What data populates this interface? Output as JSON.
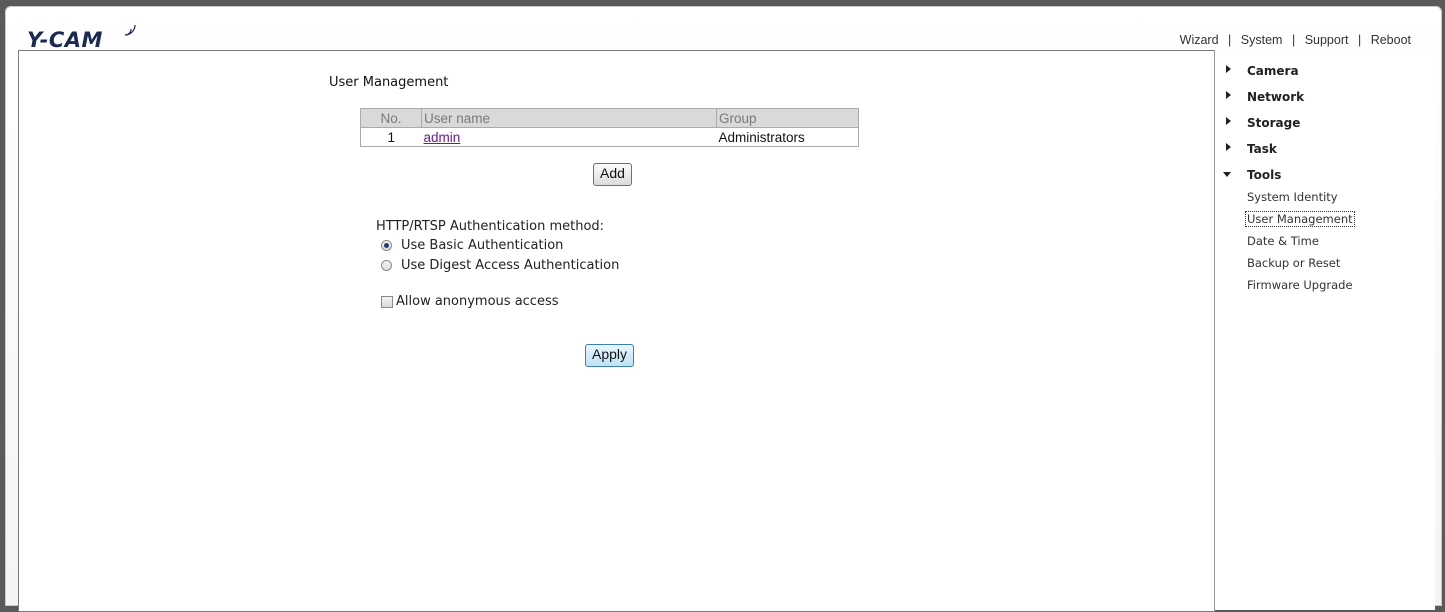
{
  "brand": {
    "logo_text": "Y-CAM"
  },
  "topnav": [
    {
      "label": "Wizard"
    },
    {
      "label": "System"
    },
    {
      "label": "Support"
    },
    {
      "label": "Reboot"
    }
  ],
  "main": {
    "title": "User Management",
    "table": {
      "headers": [
        "No.",
        "User name",
        "Group"
      ],
      "rows": [
        {
          "no": "1",
          "username": "admin",
          "group": "Administrators"
        }
      ]
    },
    "add_button": "Add",
    "auth": {
      "label": "HTTP/RTSP Authentication method:",
      "options": [
        {
          "label": "Use Basic Authentication",
          "selected": true
        },
        {
          "label": "Use Digest Access Authentication",
          "selected": false
        }
      ]
    },
    "anonymous": {
      "label": "Allow anonymous access",
      "checked": false
    },
    "apply_button": "Apply"
  },
  "sidebar": {
    "sections": [
      {
        "label": "Camera",
        "expanded": false
      },
      {
        "label": "Network",
        "expanded": false
      },
      {
        "label": "Storage",
        "expanded": false
      },
      {
        "label": "Task",
        "expanded": false
      },
      {
        "label": "Tools",
        "expanded": true
      }
    ],
    "tools_items": [
      {
        "label": "System Identity"
      },
      {
        "label": "User Management",
        "active": true
      },
      {
        "label": "Date & Time"
      },
      {
        "label": "Backup or Reset"
      },
      {
        "label": "Firmware Upgrade"
      }
    ]
  },
  "colors": {
    "link_visited": "#6a1a8a",
    "apply_border": "#3c7fb1",
    "header_bg": "#d9d9d9"
  }
}
